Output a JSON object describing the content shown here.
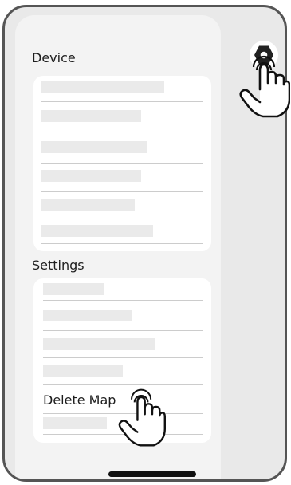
{
  "device_section": {
    "title": "Device"
  },
  "settings_section": {
    "title": "Settings",
    "delete_map_label": "Delete Map"
  },
  "icons": {
    "settings": "hexagon-gear-icon",
    "pointer": "tap-hand-icon"
  },
  "colors": {
    "frame": "#555555",
    "background": "#e9e9e9",
    "panel": "#f3f3f3",
    "card": "#ffffff",
    "placeholder": "#eaeaea",
    "divider": "#cccccc",
    "text": "#1e1e1e"
  }
}
